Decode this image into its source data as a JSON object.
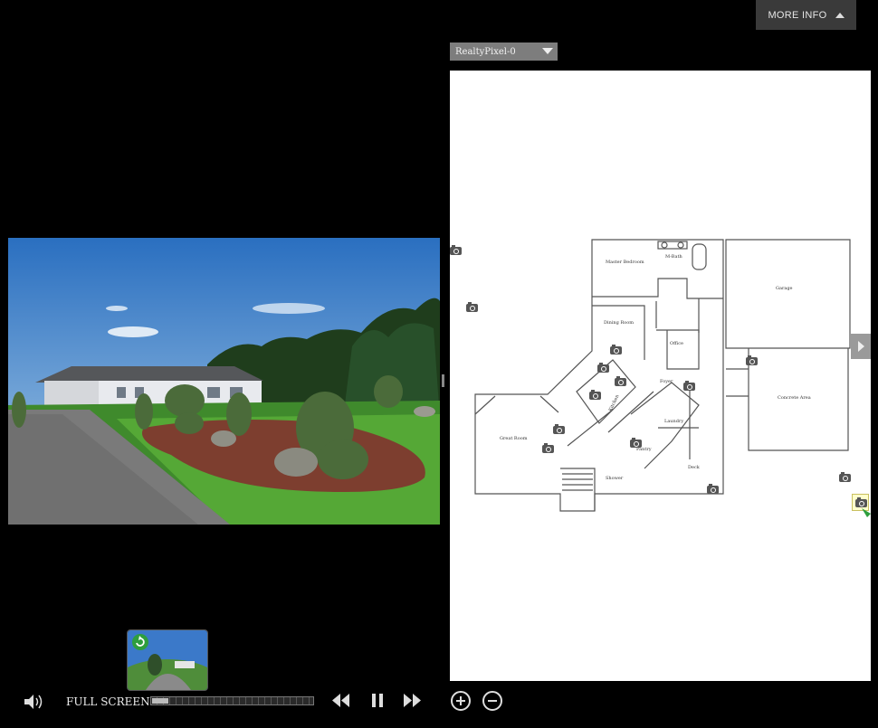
{
  "header": {
    "more_info_label": "MORE INFO"
  },
  "floor_selector": {
    "selected": "RealtyPixel-0"
  },
  "floorplan": {
    "rooms": {
      "master_bedroom": "Master Bedroom",
      "m_bath": "M-Bath",
      "dining_room": "Dining Room",
      "office": "Office",
      "foyer": "Foyer",
      "kitchen": "Kitchen",
      "great_room": "Great Room",
      "laundry": "Laundry",
      "pantry": "Pantry",
      "shower": "Shower",
      "deck": "Deck",
      "garage": "Garage",
      "concrete_area": "Concrete Area"
    }
  },
  "controls": {
    "fullscreen_label": "FULL SCREEN",
    "progress": 0.1
  },
  "colors": {
    "background": "#000000",
    "panel": "#ffffff",
    "button_dark": "#3a3a3a",
    "dropdown": "#7d7d7d",
    "accent_green": "#2e9e3e"
  }
}
